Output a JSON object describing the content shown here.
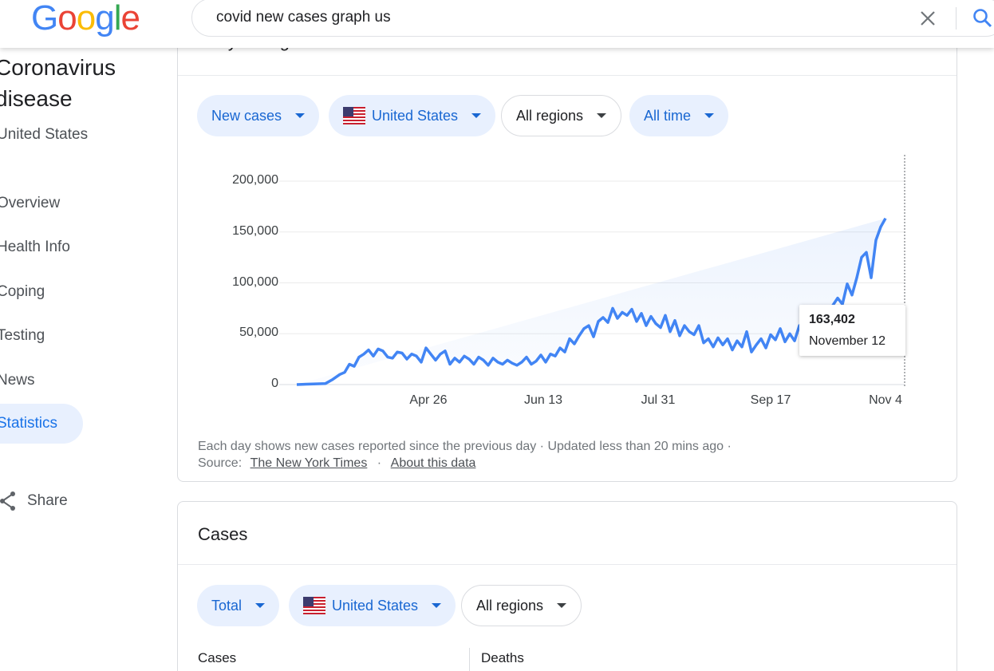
{
  "logo": {
    "letters": [
      "G",
      "o",
      "o",
      "g",
      "l",
      "e"
    ],
    "colors": [
      "#4285F4",
      "#EA4335",
      "#FBBC05",
      "#4285F4",
      "#34A853",
      "#EA4335"
    ]
  },
  "search": {
    "query": "covid new cases graph us",
    "clear_icon": "close-icon",
    "search_icon": "search-icon"
  },
  "sidebar": {
    "title": "Coronavirus disease",
    "subtitle": "United States",
    "items": [
      {
        "label": "Overview",
        "active": false
      },
      {
        "label": "Health Info",
        "active": false
      },
      {
        "label": "Coping",
        "active": false
      },
      {
        "label": "Testing",
        "active": false
      },
      {
        "label": "News",
        "active": false
      },
      {
        "label": "Statistics",
        "active": true
      }
    ],
    "share_label": "Share",
    "share_icon": "share-icon"
  },
  "daily_card": {
    "title": "Daily change",
    "filters": [
      {
        "label": "New cases",
        "style": "blue",
        "flag": false
      },
      {
        "label": "United States",
        "style": "blue",
        "flag": true
      },
      {
        "label": "All regions",
        "style": "white",
        "flag": false
      },
      {
        "label": "All time",
        "style": "white-blue",
        "flag": false
      }
    ],
    "footnote": "Each day shows new cases reported since the previous day · Updated less than 20 mins ago ·",
    "source_label": "Source:",
    "source_link": "The New York Times",
    "source_sep": "·",
    "about_link": "About this data",
    "tooltip": {
      "value": "163,402",
      "date": "November 12"
    }
  },
  "chart_data": {
    "type": "line",
    "title": "",
    "xlabel": "",
    "ylabel": "",
    "ylim": [
      0,
      200000
    ],
    "yticks": [
      "0",
      "50,000",
      "100,000",
      "150,000",
      "200,000"
    ],
    "ytick_values": [
      0,
      50000,
      100000,
      150000,
      200000
    ],
    "xticks": [
      "Apr 26",
      "Jun 13",
      "Jul 31",
      "Sep 17",
      "Nov 4"
    ],
    "xtick_days": [
      55,
      103,
      151,
      198,
      246
    ],
    "series": [
      {
        "color": "#4285f4",
        "x_days": [
          0,
          12,
          15,
          18,
          20,
          22,
          24,
          26,
          28,
          30,
          32,
          34,
          36,
          38,
          40,
          42,
          44,
          46,
          48,
          50,
          52,
          54,
          56,
          58,
          60,
          62,
          64,
          66,
          68,
          70,
          72,
          74,
          76,
          78,
          80,
          82,
          84,
          86,
          88,
          90,
          92,
          94,
          96,
          98,
          100,
          102,
          104,
          106,
          108,
          110,
          112,
          114,
          116,
          118,
          120,
          122,
          124,
          126,
          128,
          130,
          132,
          134,
          136,
          138,
          140,
          142,
          144,
          146,
          148,
          150,
          152,
          154,
          156,
          158,
          160,
          162,
          164,
          166,
          168,
          170,
          172,
          174,
          176,
          178,
          180,
          182,
          184,
          186,
          188,
          190,
          192,
          194,
          196,
          198,
          200,
          202,
          204,
          206,
          208,
          210,
          212,
          214,
          216,
          218,
          220,
          222,
          224,
          226,
          228,
          230,
          232,
          234,
          236,
          238,
          240,
          242,
          244,
          246,
          248,
          250,
          252,
          254
        ],
        "values": [
          0,
          1000,
          5000,
          10000,
          12000,
          20000,
          18000,
          27000,
          30000,
          34000,
          28000,
          35000,
          33000,
          27000,
          26000,
          32000,
          31000,
          25000,
          30000,
          28000,
          22000,
          36000,
          30000,
          24000,
          30000,
          33000,
          20000,
          26000,
          22000,
          28000,
          25000,
          20000,
          27000,
          24000,
          19000,
          26000,
          22000,
          20000,
          24000,
          21000,
          19000,
          22000,
          27000,
          20000,
          23000,
          29000,
          22000,
          30000,
          28000,
          36000,
          32000,
          45000,
          40000,
          48000,
          55000,
          58000,
          47000,
          62000,
          66000,
          61000,
          75000,
          65000,
          71000,
          68000,
          74000,
          62000,
          70000,
          58000,
          67000,
          60000,
          56000,
          68000,
          52000,
          63000,
          48000,
          58000,
          52000,
          49000,
          58000,
          41000,
          45000,
          37000,
          46000,
          39000,
          45000,
          34000,
          43000,
          37000,
          52000,
          32000,
          39000,
          45000,
          36000,
          49000,
          44000,
          55000,
          42000,
          50000,
          43000,
          58000,
          49000,
          55000,
          60000,
          58000,
          66000,
          70000,
          78000,
          85000,
          79000,
          99000,
          88000,
          105000,
          125000,
          130000,
          105000,
          142000,
          155000,
          163402
        ]
      }
    ]
  },
  "cases_card": {
    "title": "Cases",
    "filters": [
      {
        "label": "Total",
        "style": "blue",
        "flag": false
      },
      {
        "label": "United States",
        "style": "blue",
        "flag": true
      },
      {
        "label": "All regions",
        "style": "white",
        "flag": false
      }
    ],
    "col_cases": "Cases",
    "col_deaths": "Deaths"
  }
}
